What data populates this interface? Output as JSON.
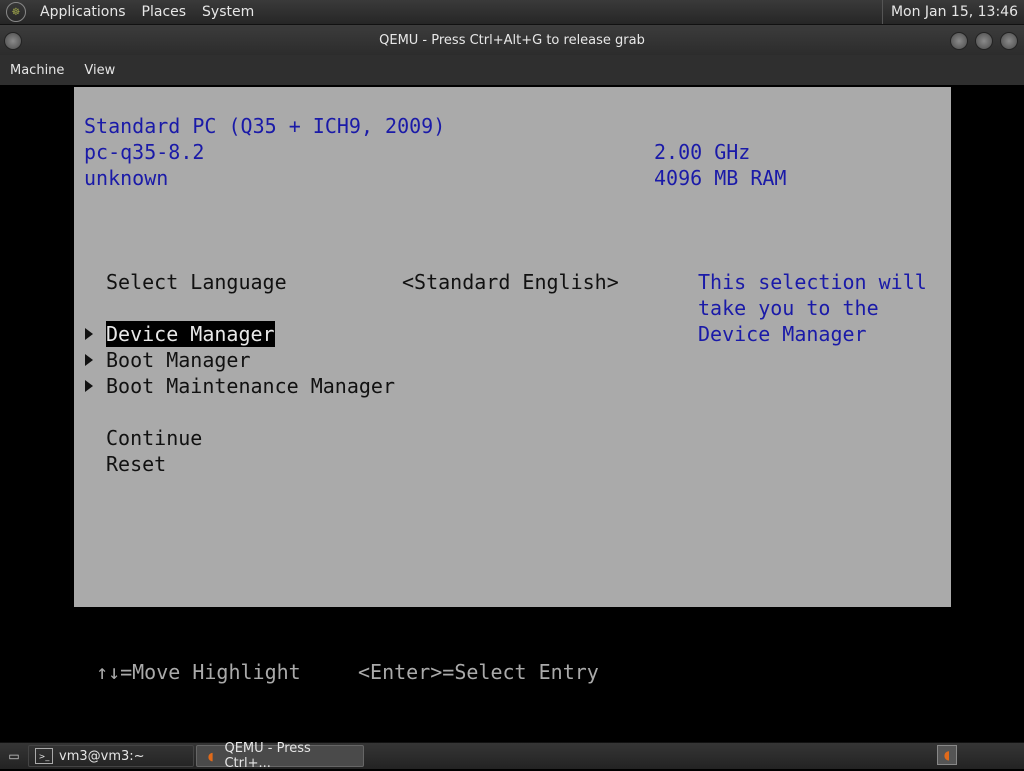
{
  "top_panel": {
    "menus": [
      "Applications",
      "Places",
      "System"
    ],
    "clock": "Mon Jan 15, 13:46"
  },
  "window": {
    "title": "QEMU - Press Ctrl+Alt+G to release grab",
    "menus": [
      "Machine",
      "View"
    ]
  },
  "bios": {
    "platform": "Standard PC (Q35 + ICH9, 2009)",
    "version": "pc-q35-8.2",
    "serial": "unknown",
    "cpu_speed": "2.00 GHz",
    "memory": "4096 MB RAM",
    "language_label": "Select Language",
    "language_value": "<Standard English>",
    "menu_items": [
      "Device Manager",
      "Boot Manager",
      "Boot Maintenance Manager"
    ],
    "selected_item": "Device Manager",
    "actions": [
      "Continue",
      "Reset"
    ],
    "help_lines": [
      "This selection will",
      "take you to the",
      "Device Manager"
    ],
    "footer_move": "↑↓=Move Highlight",
    "footer_enter": "<Enter>=Select Entry"
  },
  "taskbar": {
    "tasks": [
      {
        "label": "vm3@vm3:~",
        "icon": "terminal-icon"
      },
      {
        "label": "QEMU - Press Ctrl+...",
        "icon": "qemu-icon"
      }
    ]
  },
  "colors": {
    "bios_background": "#aaaaaa",
    "bios_info_text": "#1a1aa8",
    "selection_background": "#000000"
  }
}
